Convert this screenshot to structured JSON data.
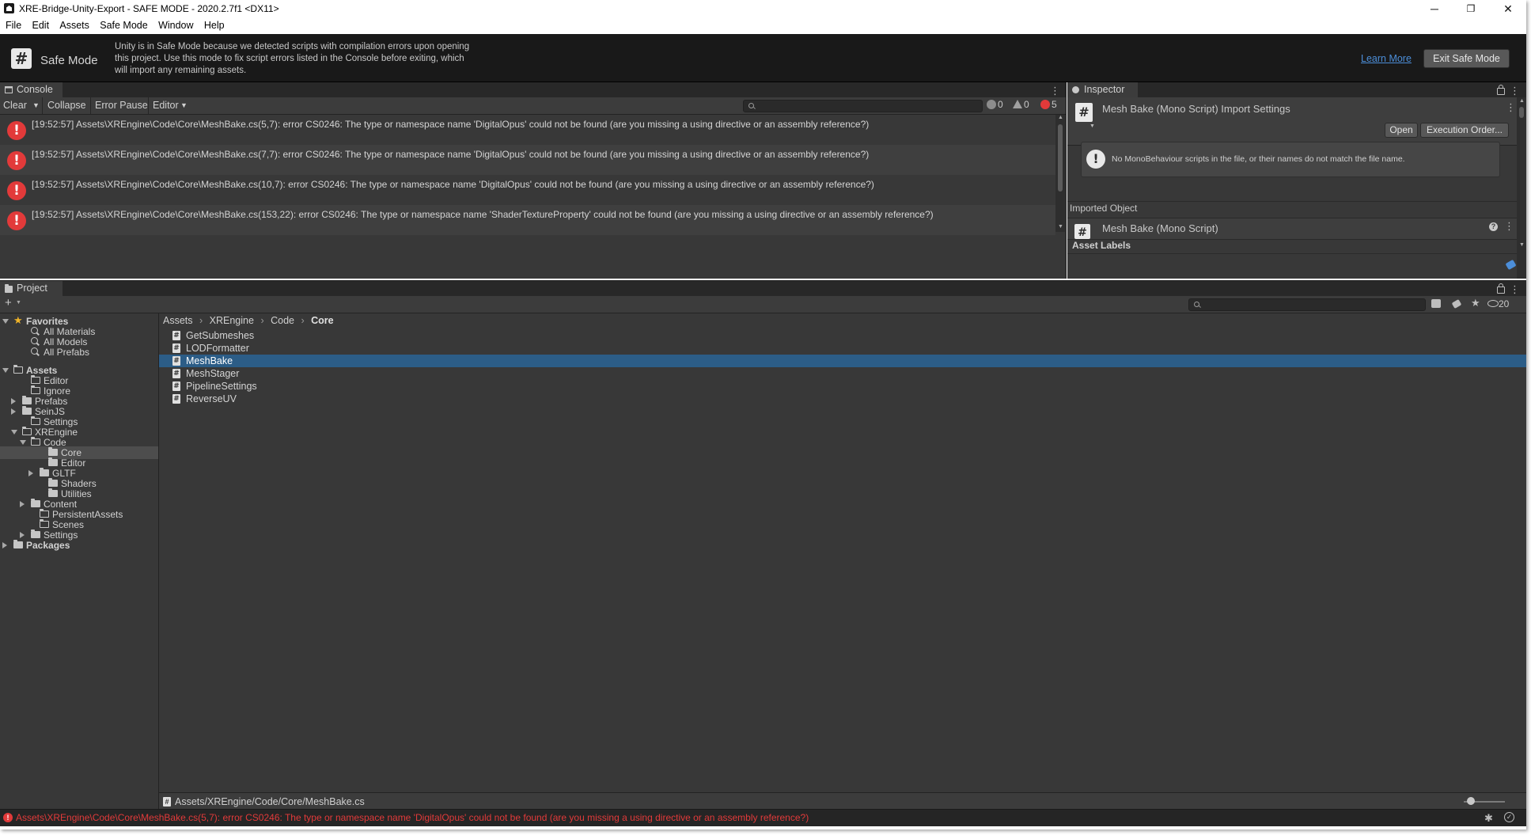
{
  "window": {
    "title": "XRE-Bridge-Unity-Export - SAFE MODE - 2020.2.7f1 <DX11>",
    "minimize_glyph": "─",
    "restore_glyph": "❐",
    "close_glyph": "✕"
  },
  "menubar": {
    "items": [
      "File",
      "Edit",
      "Assets",
      "Safe Mode",
      "Window",
      "Help"
    ]
  },
  "safe_mode": {
    "icon": "#",
    "title": "Safe Mode",
    "description": "Unity is in Safe Mode because we detected scripts with compilation errors upon opening this project. Use this mode to fix script errors listed in the Console before exiting, which will import any remaining assets.",
    "learn_more": "Learn More",
    "exit_button": "Exit Safe Mode"
  },
  "console": {
    "tab": "Console",
    "toolbar": {
      "clear": "Clear",
      "collapse": "Collapse",
      "error_pause": "Error Pause",
      "editor": "Editor"
    },
    "counts": {
      "info": "0",
      "warnings": "0",
      "errors": "5"
    },
    "error_glyph": "!",
    "entries": [
      "[19:52:57] Assets\\XREngine\\Code\\Core\\MeshBake.cs(5,7): error CS0246: The type or namespace name 'DigitalOpus' could not be found (are you missing a using directive or an assembly reference?)",
      "[19:52:57] Assets\\XREngine\\Code\\Core\\MeshBake.cs(7,7): error CS0246: The type or namespace name 'DigitalOpus' could not be found (are you missing a using directive or an assembly reference?)",
      "[19:52:57] Assets\\XREngine\\Code\\Core\\MeshBake.cs(10,7): error CS0246: The type or namespace name 'DigitalOpus' could not be found (are you missing a using directive or an assembly reference?)",
      "[19:52:57] Assets\\XREngine\\Code\\Core\\MeshBake.cs(153,22): error CS0246: The type or namespace name 'ShaderTextureProperty' could not be found (are you missing a using directive or an assembly reference?)"
    ]
  },
  "inspector": {
    "tab": "Inspector",
    "header_title": "Mesh Bake (Mono Script) Import Settings",
    "open_button": "Open",
    "execution_order_button": "Execution Order...",
    "help_text": "No MonoBehaviour scripts in the file, or their names do not match the file name.",
    "imported_object_label": "Imported Object",
    "imported_object_name": "Mesh Bake (Mono Script)",
    "asset_labels": "Asset Labels"
  },
  "project": {
    "tab": "Project",
    "hidden_count": "20",
    "tree": [
      {
        "label": "Favorites",
        "kind": "star",
        "depth": 0,
        "arrow": "down",
        "bold": true
      },
      {
        "label": "All Materials",
        "kind": "search",
        "depth": 2
      },
      {
        "label": "All Models",
        "kind": "search",
        "depth": 2
      },
      {
        "label": "All Prefabs",
        "kind": "search",
        "depth": 2
      },
      {
        "label": "Assets",
        "kind": "folder-open",
        "depth": 0,
        "arrow": "down",
        "bold": true,
        "gap": true
      },
      {
        "label": "Editor",
        "kind": "folder-open",
        "depth": 2
      },
      {
        "label": "Ignore",
        "kind": "folder-open",
        "depth": 2
      },
      {
        "label": "Prefabs",
        "kind": "folder",
        "depth": 1,
        "arrow": "right"
      },
      {
        "label": "SeinJS",
        "kind": "folder",
        "depth": 1,
        "arrow": "right"
      },
      {
        "label": "Settings",
        "kind": "folder-open",
        "depth": 2
      },
      {
        "label": "XREngine",
        "kind": "folder-open",
        "depth": 1,
        "arrow": "down"
      },
      {
        "label": "Code",
        "kind": "folder-open",
        "depth": 2,
        "arrow": "down"
      },
      {
        "label": "Core",
        "kind": "folder",
        "depth": 4,
        "selected": true
      },
      {
        "label": "Editor",
        "kind": "folder",
        "depth": 4
      },
      {
        "label": "GLTF",
        "kind": "folder",
        "depth": 3,
        "arrow": "right"
      },
      {
        "label": "Shaders",
        "kind": "folder",
        "depth": 4
      },
      {
        "label": "Utilities",
        "kind": "folder",
        "depth": 4
      },
      {
        "label": "Content",
        "kind": "folder",
        "depth": 2,
        "arrow": "right"
      },
      {
        "label": "PersistentAssets",
        "kind": "folder-open",
        "depth": 3
      },
      {
        "label": "Scenes",
        "kind": "folder-open",
        "depth": 3
      },
      {
        "label": "Settings",
        "kind": "folder",
        "depth": 2,
        "arrow": "right"
      },
      {
        "label": "Packages",
        "kind": "folder",
        "depth": 0,
        "arrow": "right",
        "bold": true
      }
    ],
    "breadcrumb": [
      "Assets",
      "XREngine",
      "Code",
      "Core"
    ],
    "files": [
      "GetSubmeshes",
      "LODFormatter",
      "MeshBake",
      "MeshStager",
      "PipelineSettings",
      "ReverseUV"
    ],
    "selected_file": "MeshBake",
    "selected_path": "Assets/XREngine/Code/Core/MeshBake.cs"
  },
  "status": {
    "message": "Assets\\XREngine\\Code\\Core\\MeshBake.cs(5,7): error CS0246: The type or namespace name 'DigitalOpus' could not be found (are you missing a using directive or an assembly reference?)"
  },
  "colors": {
    "error": "#e23a3a",
    "selection": "#2c5d87",
    "link": "#4c8ed9",
    "favorites_star": "#f0b429"
  }
}
